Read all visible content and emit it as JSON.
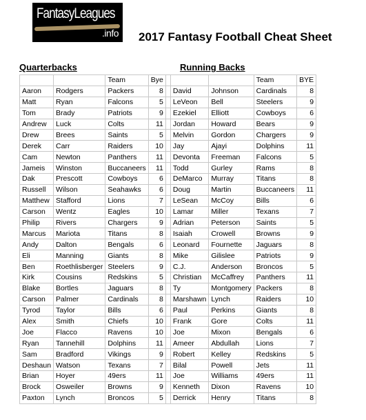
{
  "logo": {
    "brand": "FantasyLeagues",
    "tld": ".info"
  },
  "title": "2017 Fantasy Football Cheat Sheet",
  "quarterbacks": {
    "heading": "Quarterbacks",
    "columns": [
      "",
      "",
      "Team",
      "Bye"
    ],
    "rows": [
      [
        "Aaron",
        "Rodgers",
        "Packers",
        "8"
      ],
      [
        "Matt",
        "Ryan",
        "Falcons",
        "5"
      ],
      [
        "Tom",
        "Brady",
        "Patriots",
        "9"
      ],
      [
        "Andrew",
        "Luck",
        "Colts",
        "11"
      ],
      [
        "Drew",
        "Brees",
        "Saints",
        "5"
      ],
      [
        "Derek",
        "Carr",
        "Raiders",
        "10"
      ],
      [
        "Cam",
        "Newton",
        "Panthers",
        "11"
      ],
      [
        "Jameis",
        "Winston",
        "Buccaneers",
        "11"
      ],
      [
        "Dak",
        "Prescott",
        "Cowboys",
        "6"
      ],
      [
        "Russell",
        "Wilson",
        "Seahawks",
        "6"
      ],
      [
        "Matthew",
        "Stafford",
        "Lions",
        "7"
      ],
      [
        "Carson",
        "Wentz",
        "Eagles",
        "10"
      ],
      [
        "Philip",
        "Rivers",
        "Chargers",
        "9"
      ],
      [
        "Marcus",
        "Mariota",
        "Titans",
        "8"
      ],
      [
        "Andy",
        "Dalton",
        "Bengals",
        "6"
      ],
      [
        "Eli",
        "Manning",
        "Giants",
        "8"
      ],
      [
        "Ben",
        "Roethlisberger",
        "Steelers",
        "9"
      ],
      [
        "Kirk",
        "Cousins",
        "Redskins",
        "5"
      ],
      [
        "Blake",
        "Bortles",
        "Jaguars",
        "8"
      ],
      [
        "Carson",
        "Palmer",
        "Cardinals",
        "8"
      ],
      [
        "Tyrod",
        "Taylor",
        "Bills",
        "6"
      ],
      [
        "Alex",
        "Smith",
        "Chiefs",
        "10"
      ],
      [
        "Joe",
        "Flacco",
        "Ravens",
        "10"
      ],
      [
        "Ryan",
        "Tannehill",
        "Dolphins",
        "11"
      ],
      [
        "Sam",
        "Bradford",
        "Vikings",
        "9"
      ],
      [
        "Deshaun",
        "Watson",
        "Texans",
        "7"
      ],
      [
        "Brian",
        "Hoyer",
        "49ers",
        "11"
      ],
      [
        "Brock",
        "Osweiler",
        "Browns",
        "9"
      ],
      [
        "Paxton",
        "Lynch",
        "Broncos",
        "5"
      ]
    ]
  },
  "running_backs": {
    "heading": "Running Backs",
    "columns": [
      "",
      "",
      "Team",
      "BYE"
    ],
    "rows": [
      [
        "David",
        "Johnson",
        "Cardinals",
        "8"
      ],
      [
        "LeVeon",
        "Bell",
        "Steelers",
        "9"
      ],
      [
        "Ezekiel",
        "Elliott",
        "Cowboys",
        "6"
      ],
      [
        "Jordan",
        "Howard",
        "Bears",
        "9"
      ],
      [
        "Melvin",
        "Gordon",
        "Chargers",
        "9"
      ],
      [
        "Jay",
        "Ajayi",
        "Dolphins",
        "11"
      ],
      [
        "Devonta",
        "Freeman",
        "Falcons",
        "5"
      ],
      [
        "Todd",
        "Gurley",
        "Rams",
        "8"
      ],
      [
        "DeMarco",
        "Murray",
        "Titans",
        "8"
      ],
      [
        "Doug",
        "Martin",
        "Buccaneers",
        "11"
      ],
      [
        "LeSean",
        "McCoy",
        "Bills",
        "6"
      ],
      [
        "Lamar",
        "Miller",
        "Texans",
        "7"
      ],
      [
        "Adrian",
        "Peterson",
        "Saints",
        "5"
      ],
      [
        "Isaiah",
        "Crowell",
        "Browns",
        "9"
      ],
      [
        "Leonard",
        "Fournette",
        "Jaguars",
        "8"
      ],
      [
        "Mike",
        "Gilislee",
        "Patriots",
        "9"
      ],
      [
        "C.J.",
        "Anderson",
        "Broncos",
        "5"
      ],
      [
        "Christian",
        "McCaffrey",
        "Panthers",
        "11"
      ],
      [
        "Ty",
        "Montgomery",
        "Packers",
        "8"
      ],
      [
        "Marshawn",
        "Lynch",
        "Raiders",
        "10"
      ],
      [
        "Paul",
        "Perkins",
        "Giants",
        "8"
      ],
      [
        "Frank",
        "Gore",
        "Colts",
        "11"
      ],
      [
        "Joe",
        "Mixon",
        "Bengals",
        "6"
      ],
      [
        "Ameer",
        "Abdullah",
        "Lions",
        "7"
      ],
      [
        "Robert",
        "Kelley",
        "Redskins",
        "5"
      ],
      [
        "Bilal",
        "Powell",
        "Jets",
        "11"
      ],
      [
        "Joe",
        "Williams",
        "49ers",
        "11"
      ],
      [
        "Kenneth",
        "Dixon",
        "Ravens",
        "10"
      ],
      [
        "Derrick",
        "Henry",
        "Titans",
        "8"
      ]
    ]
  }
}
